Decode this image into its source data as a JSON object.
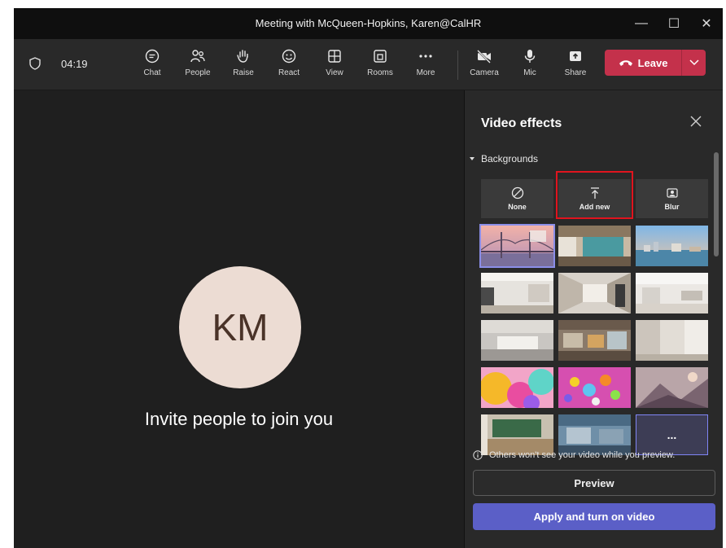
{
  "window": {
    "title": "Meeting with McQueen-Hopkins, Karen@CalHR",
    "minimize": "—",
    "maximize": "☐",
    "close": "✕"
  },
  "toolbar": {
    "timer": "04:19",
    "buttons": [
      {
        "label": "Chat",
        "icon": "chat-icon"
      },
      {
        "label": "People",
        "icon": "people-icon"
      },
      {
        "label": "Raise",
        "icon": "hand-icon"
      },
      {
        "label": "React",
        "icon": "smiley-icon"
      },
      {
        "label": "View",
        "icon": "grid-icon"
      },
      {
        "label": "Rooms",
        "icon": "rooms-icon"
      },
      {
        "label": "More",
        "icon": "ellipsis-icon"
      },
      {
        "label": "Camera",
        "icon": "camera-off-icon"
      },
      {
        "label": "Mic",
        "icon": "mic-icon"
      },
      {
        "label": "Share",
        "icon": "share-icon"
      }
    ],
    "leave_label": "Leave",
    "leave_color": "#c4314b"
  },
  "stage": {
    "initials": "KM",
    "invite_text": "Invite people to join you"
  },
  "panel": {
    "title": "Video effects",
    "section": "Backgrounds",
    "options": [
      {
        "label": "None",
        "icon": "none-icon"
      },
      {
        "label": "Add new",
        "icon": "upload-icon"
      },
      {
        "label": "Blur",
        "icon": "blur-icon"
      }
    ],
    "more_label": "...",
    "note": "Others won't see your video while you preview.",
    "preview_label": "Preview",
    "apply_label": "Apply and turn on video",
    "accent": "#5b5fc7"
  }
}
